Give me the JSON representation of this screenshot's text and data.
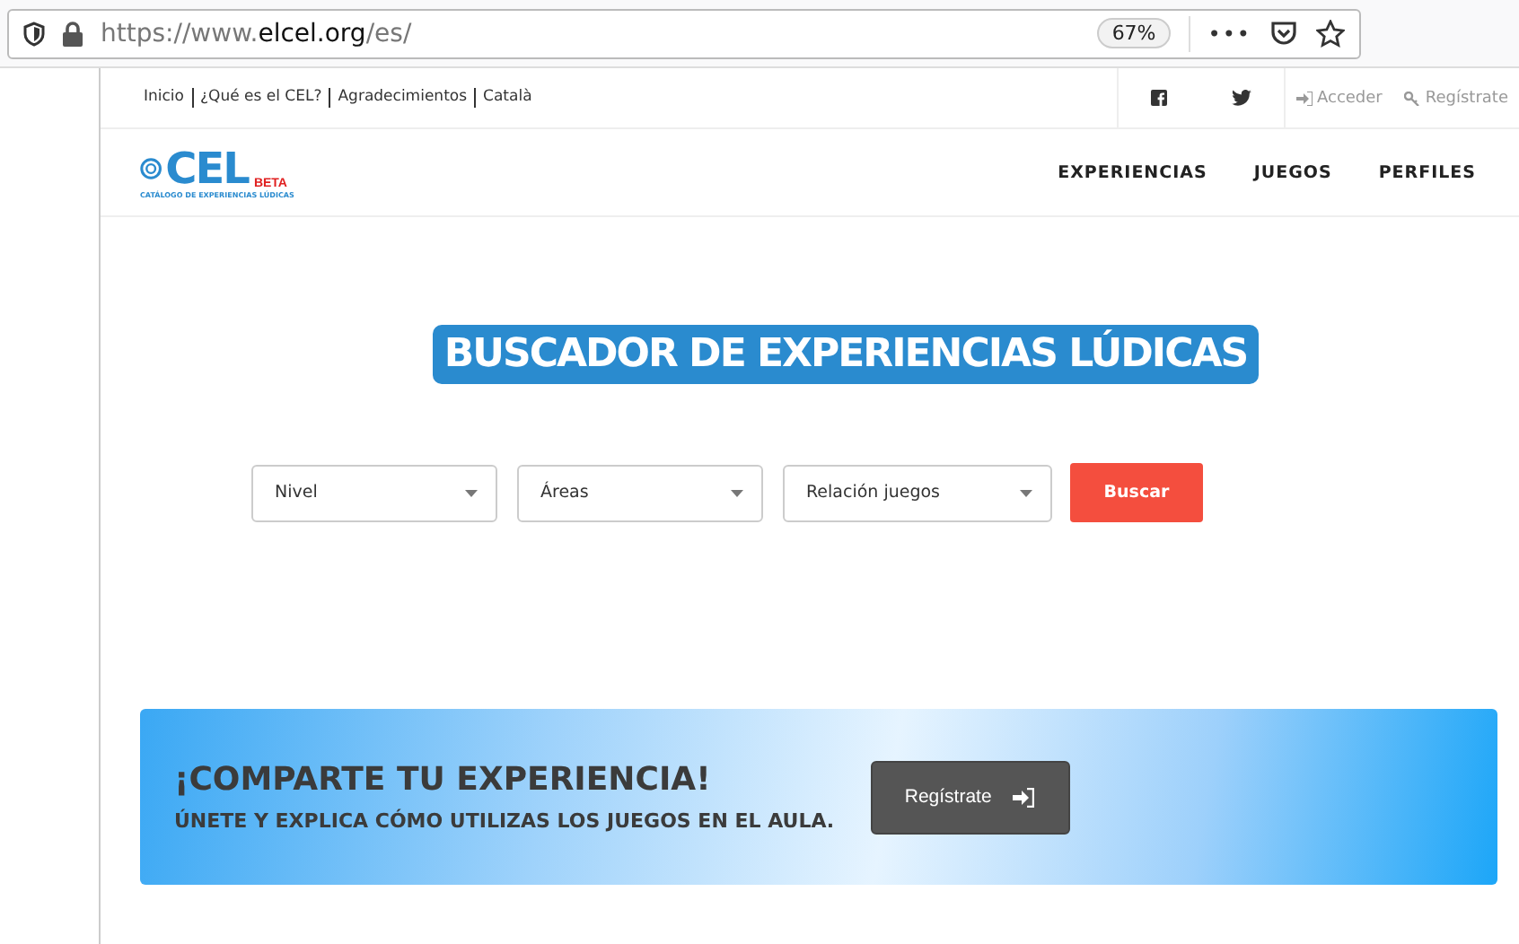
{
  "browser": {
    "url_prefix": "https://www.",
    "url_domain": "elcel.org",
    "url_path": "/es/",
    "zoom": "67%",
    "menu": "•••"
  },
  "topbar": {
    "links": [
      "Inicio",
      "¿Qué es el CEL?",
      "Agradecimientos",
      "Català"
    ],
    "login": "Acceder",
    "register": "Regístrate"
  },
  "header": {
    "logo": {
      "name": "CEL",
      "badge": "BETA",
      "subtitle": "CATÁLOGO DE EXPERIENCIAS LÚDICAS"
    },
    "nav": [
      "EXPERIENCIAS",
      "JUEGOS",
      "PERFILES"
    ]
  },
  "search": {
    "title": "BUSCADOR DE EXPERIENCIAS LÚDICAS",
    "filters": [
      "Nivel",
      "Áreas",
      "Relación juegos"
    ],
    "button": "Buscar"
  },
  "banner": {
    "title": "¡COMPARTE TU EXPERIENCIA!",
    "subtitle": "ÚNETE Y EXPLICA CÓMO UTILIZAS LOS JUEGOS EN EL AULA.",
    "button": "Regístrate"
  }
}
